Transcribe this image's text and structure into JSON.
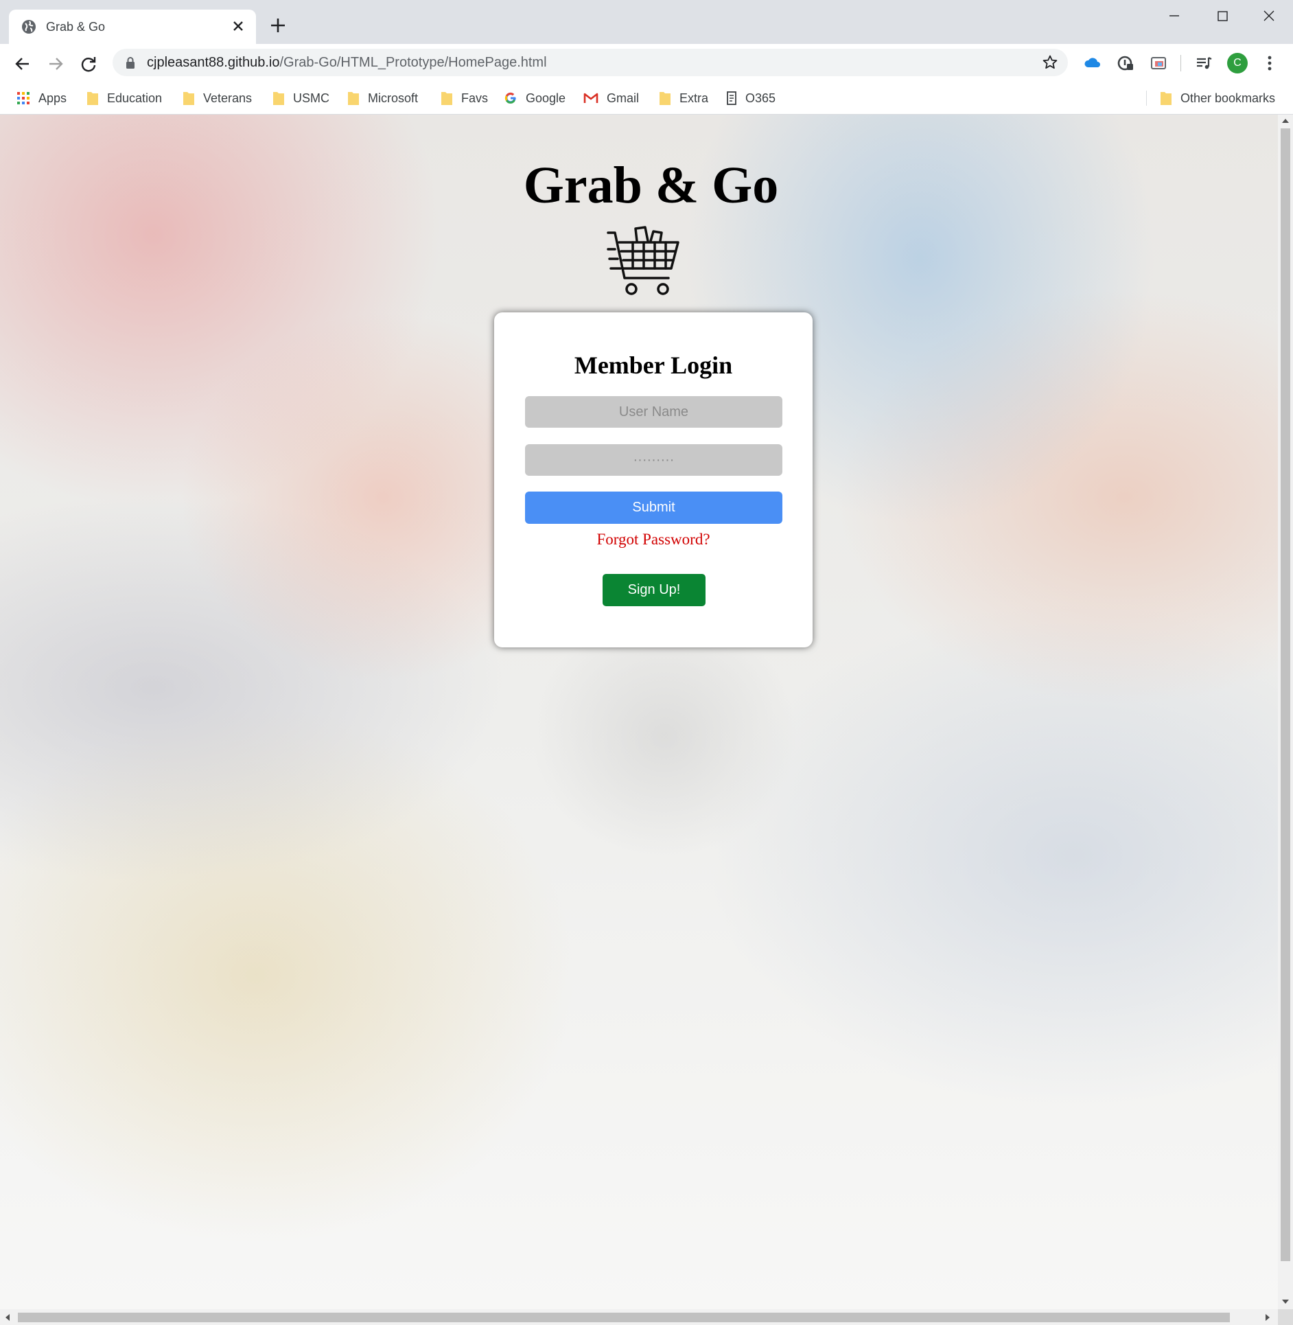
{
  "browser": {
    "tab_title": "Grab & Go",
    "url_host": "cjpleasant88.github.io",
    "url_path": "/Grab-Go/HTML_Prototype/HomePage.html",
    "profile_initial": "C",
    "profile_color": "#2e9e3e"
  },
  "bookmarks": {
    "items": [
      {
        "label": "Apps",
        "icon": "apps-grid-icon"
      },
      {
        "label": "Education",
        "icon": "folder-icon"
      },
      {
        "label": "Veterans",
        "icon": "folder-icon"
      },
      {
        "label": "USMC",
        "icon": "folder-icon"
      },
      {
        "label": "Microsoft",
        "icon": "folder-icon"
      },
      {
        "label": "Favs",
        "icon": "folder-icon"
      },
      {
        "label": "Google",
        "icon": "google-icon"
      },
      {
        "label": "Gmail",
        "icon": "gmail-icon"
      },
      {
        "label": "Extra",
        "icon": "folder-icon"
      },
      {
        "label": "O365",
        "icon": "page-icon"
      }
    ],
    "other": "Other bookmarks"
  },
  "page": {
    "brand_title": "Grab & Go",
    "login": {
      "heading": "Member Login",
      "username_placeholder": "User Name",
      "password_placeholder": "·········",
      "submit_label": "Submit",
      "forgot_label": "Forgot Password?",
      "signup_label": "Sign Up!"
    }
  },
  "colors": {
    "submit": "#4a8ff5",
    "signup": "#0a8533",
    "forgot_link": "#d10000",
    "field_bg": "#c8c8c8"
  }
}
